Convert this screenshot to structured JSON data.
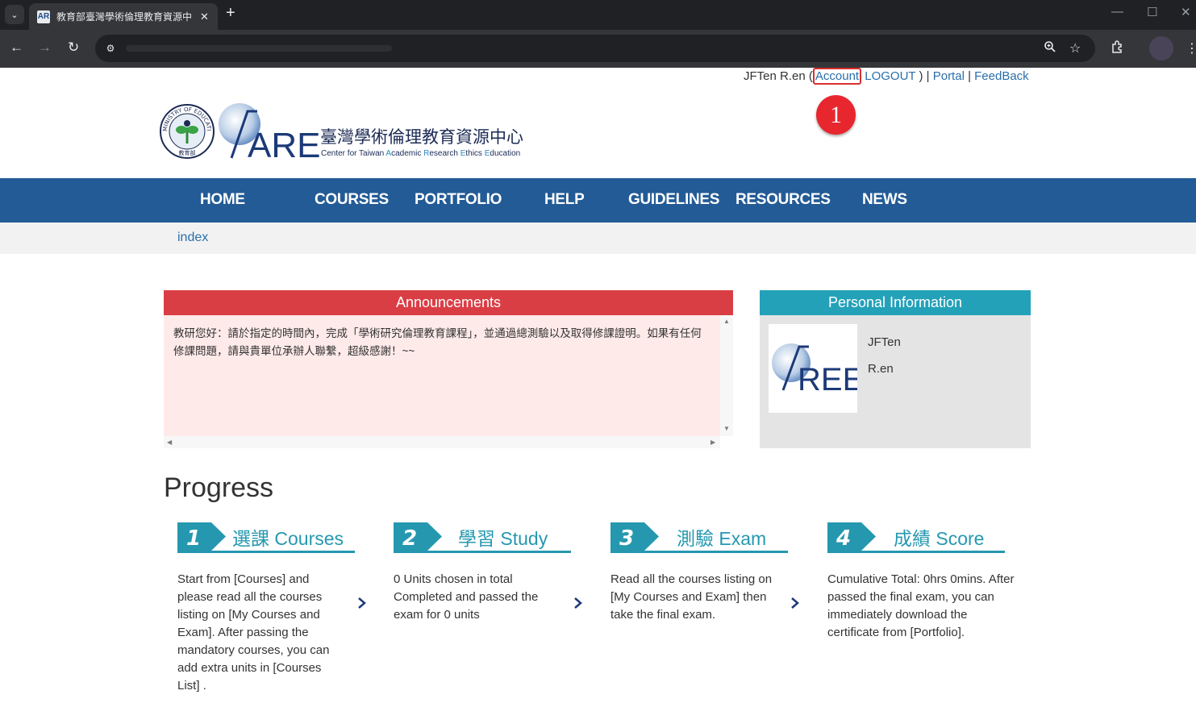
{
  "browser": {
    "tab_title": "教育部臺灣學術倫理教育資源中",
    "tab_favicon": "AR",
    "new_tab": "+",
    "minimize": "—",
    "maximize": "☐",
    "close": "✕"
  },
  "userbar": {
    "user_name": "JFTen R.en",
    "open_paren": " (",
    "account": "Account",
    "logout": " LOGOUT ",
    "close_paren_sep": ") | ",
    "portal": "Portal",
    "sep": " | ",
    "feedback": "FeedBack"
  },
  "callout_number": "1",
  "logo": {
    "chinese_name": "臺灣學術倫理教育資源中心",
    "english_parts": [
      "Center for Taiwan ",
      "A",
      "cademic ",
      "R",
      "esearch ",
      "E",
      "thics ",
      "E",
      "ducation"
    ],
    "aree_text": "AREE",
    "seal_text": "MINISTRY OF EDUCATION",
    "seal_cn": "教育部"
  },
  "nav": {
    "items": [
      "HOME",
      "COURSES",
      "PORTFOLIO",
      "HELP",
      "GUIDELINES",
      "RESOURCES",
      "NEWS"
    ]
  },
  "breadcrumb": "index",
  "announcements": {
    "title": "Announcements",
    "text": "教研您好：請於指定的時間內，完成「學術研究倫理教育課程」，並通過總測驗以及取得修課證明。如果有任何修課問題，請與貴單位承辦人聯繫，超級感謝！~~"
  },
  "personal": {
    "title": "Personal Information",
    "first_name": "JFTen",
    "last_name": "R.en"
  },
  "progress": {
    "title": "Progress",
    "steps": [
      {
        "number": "1",
        "label": "選課 Courses",
        "text": "Start from [Courses] and please read all the courses listing on [My Courses and Exam]. After passing the mandatory courses, you can add extra units in [Courses List] ."
      },
      {
        "number": "2",
        "label": "學習 Study",
        "text": "0 Units chosen in total Completed and passed the exam for 0 units"
      },
      {
        "number": "3",
        "label": "測驗 Exam",
        "text": "Read all the courses listing on [My Courses and Exam] then take the final exam."
      },
      {
        "number": "4",
        "label": "成績 Score",
        "text": "Cumulative Total: 0hrs 0mins. After passed the final exam, you can immediately download the certificate from [Portfolio]."
      }
    ]
  },
  "colors": {
    "nav_bg": "#235b96",
    "announce_head": "#da3e45",
    "announce_body": "#ffeaea",
    "personal_head": "#23a1b9",
    "step_accent": "#2598b0",
    "link": "#2a6faa",
    "callout": "#e8262e"
  }
}
